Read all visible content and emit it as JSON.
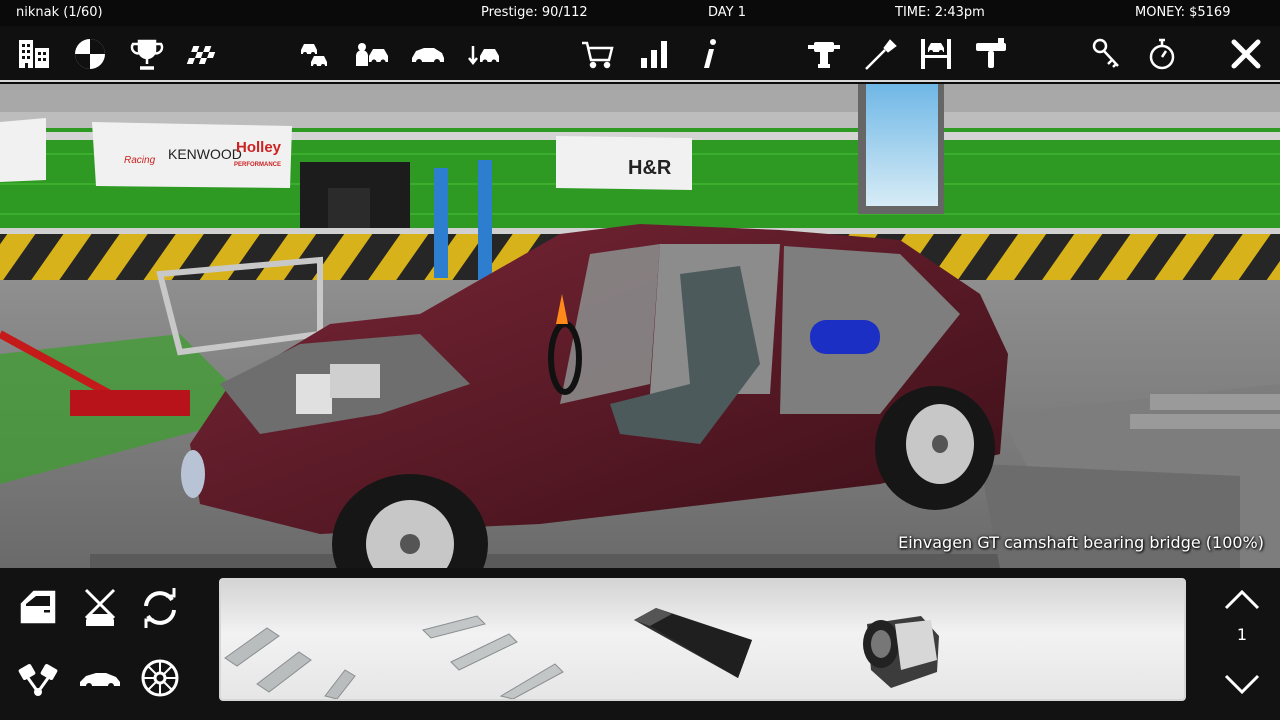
{
  "status": {
    "player": "niknak (1/60)",
    "prestige": "Prestige: 90/112",
    "day": "DAY 1",
    "time": "TIME: 2:43pm",
    "money": "MONEY: $5169"
  },
  "toolbar": {
    "icons": [
      "garage-buildings-icon",
      "race-flag-icon",
      "trophy-icon",
      "checkered-flag-icon",
      "car-pair-icon",
      "car-dealer-icon",
      "car-side-icon",
      "car-swap-icon",
      "shopping-cart-icon",
      "stats-bars-icon",
      "info-icon",
      "power-drill-icon",
      "screwdriver-icon",
      "car-lift-icon",
      "paint-gun-icon",
      "car-keys-icon",
      "stopwatch-icon",
      "close-icon"
    ]
  },
  "scene": {
    "banners": [
      "Racing",
      "KENWOOD",
      "Holley",
      "PERFORMANCE",
      "H&R"
    ],
    "caption": "Einvagen GT camshaft bearing bridge (100%)"
  },
  "bottom": {
    "tools": [
      "car-door-tool-icon",
      "car-repair-tools-icon",
      "rotate-refresh-icon",
      "engine-piston-icon",
      "car-silhouette-icon",
      "wheel-rim-icon"
    ],
    "parts": [
      "camshaft-bearing-caps",
      "camshaft-bearing-bridge",
      "engine-oil-pan",
      "alternator"
    ],
    "page": "1"
  },
  "colors": {
    "accent": "#ffffff",
    "wall_green": "#2f9a23",
    "car_paint": "#5a1a26",
    "hazard_yellow": "#d8b21a"
  }
}
